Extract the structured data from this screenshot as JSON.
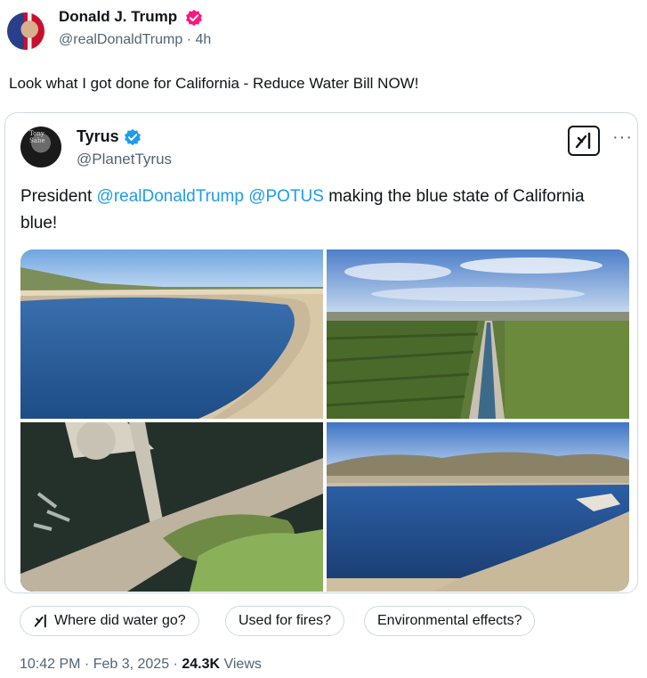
{
  "post": {
    "author_name": "Donald J. Trump",
    "handle": "@realDonaldTrump",
    "time_sep": "·",
    "time": "4h",
    "text": "Look what I got done for California - Reduce Water Bill NOW!"
  },
  "quote": {
    "author_name": "Tyrus",
    "handle": "@PlanetTyrus",
    "avatar_text": "Tony Sabe",
    "text_prefix": "President ",
    "mention1": "@realDonaldTrump",
    "mention2": "@POTUS",
    "text_suffix": " making the blue state of California blue!",
    "more_icon": "···"
  },
  "chips": [
    {
      "label": "Where did water go?",
      "icon": "grok-icon"
    },
    {
      "label": "Used for fires?"
    },
    {
      "label": "Environmental effects?"
    }
  ],
  "meta": {
    "time": "10:42 PM",
    "sep1": " · ",
    "date": "Feb 3, 2025",
    "sep2": " · ",
    "views": "24.3K",
    "views_label": " Views"
  },
  "colors": {
    "link": "#1d9bf0",
    "verified_red": "#f91880",
    "verified_blue": "#1d9bf0",
    "muted": "#536471"
  }
}
